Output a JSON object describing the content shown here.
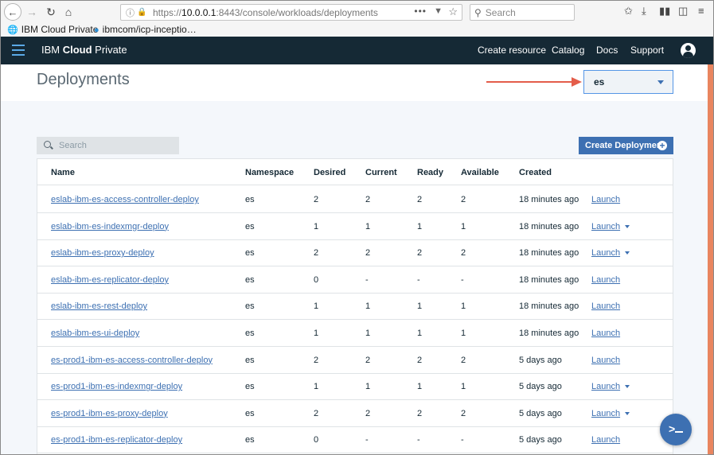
{
  "browser": {
    "url_prefix": "https://",
    "url_host": "10.0.0.1",
    "url_rest": ":8443/console/workloads/deployments",
    "search_placeholder": "Search",
    "bookmarks": [
      {
        "label": "IBM Cloud Private"
      },
      {
        "label": "ibmcom/icp-inceptio…"
      }
    ]
  },
  "header": {
    "brand_light": "IBM ",
    "brand_bold": "Cloud",
    "brand_end": " Private",
    "nav": [
      "Create resource",
      "Catalog",
      "Docs",
      "Support"
    ]
  },
  "page": {
    "title": "Deployments",
    "namespace_selected": "es",
    "search_placeholder": "Search",
    "create_button": "Create Deployment"
  },
  "colors": {
    "appbar": "#152935",
    "accent": "#3d70b2",
    "annotation_arrow": "#e45d4a"
  },
  "table": {
    "columns": [
      "Name",
      "Namespace",
      "Desired",
      "Current",
      "Ready",
      "Available",
      "Created"
    ],
    "rows": [
      {
        "name": "eslab-ibm-es-access-controller-deploy",
        "namespace": "es",
        "desired": "2",
        "current": "2",
        "ready": "2",
        "available": "2",
        "created": "18 minutes ago",
        "action": "Launch",
        "has_menu": false
      },
      {
        "name": "eslab-ibm-es-indexmgr-deploy",
        "namespace": "es",
        "desired": "1",
        "current": "1",
        "ready": "1",
        "available": "1",
        "created": "18 minutes ago",
        "action": "Launch",
        "has_menu": true
      },
      {
        "name": "eslab-ibm-es-proxy-deploy",
        "namespace": "es",
        "desired": "2",
        "current": "2",
        "ready": "2",
        "available": "2",
        "created": "18 minutes ago",
        "action": "Launch",
        "has_menu": true
      },
      {
        "name": "eslab-ibm-es-replicator-deploy",
        "namespace": "es",
        "desired": "0",
        "current": "-",
        "ready": "-",
        "available": "-",
        "created": "18 minutes ago",
        "action": "Launch",
        "has_menu": false
      },
      {
        "name": "eslab-ibm-es-rest-deploy",
        "namespace": "es",
        "desired": "1",
        "current": "1",
        "ready": "1",
        "available": "1",
        "created": "18 minutes ago",
        "action": "Launch",
        "has_menu": false
      },
      {
        "name": "eslab-ibm-es-ui-deploy",
        "namespace": "es",
        "desired": "1",
        "current": "1",
        "ready": "1",
        "available": "1",
        "created": "18 minutes ago",
        "action": "Launch",
        "has_menu": false
      },
      {
        "name": "es-prod1-ibm-es-access-controller-deploy",
        "namespace": "es",
        "desired": "2",
        "current": "2",
        "ready": "2",
        "available": "2",
        "created": "5 days ago",
        "action": "Launch",
        "has_menu": false
      },
      {
        "name": "es-prod1-ibm-es-indexmgr-deploy",
        "namespace": "es",
        "desired": "1",
        "current": "1",
        "ready": "1",
        "available": "1",
        "created": "5 days ago",
        "action": "Launch",
        "has_menu": true
      },
      {
        "name": "es-prod1-ibm-es-proxy-deploy",
        "namespace": "es",
        "desired": "2",
        "current": "2",
        "ready": "2",
        "available": "2",
        "created": "5 days ago",
        "action": "Launch",
        "has_menu": true
      },
      {
        "name": "es-prod1-ibm-es-replicator-deploy",
        "namespace": "es",
        "desired": "0",
        "current": "-",
        "ready": "-",
        "available": "-",
        "created": "5 days ago",
        "action": "Launch",
        "has_menu": false
      }
    ]
  }
}
